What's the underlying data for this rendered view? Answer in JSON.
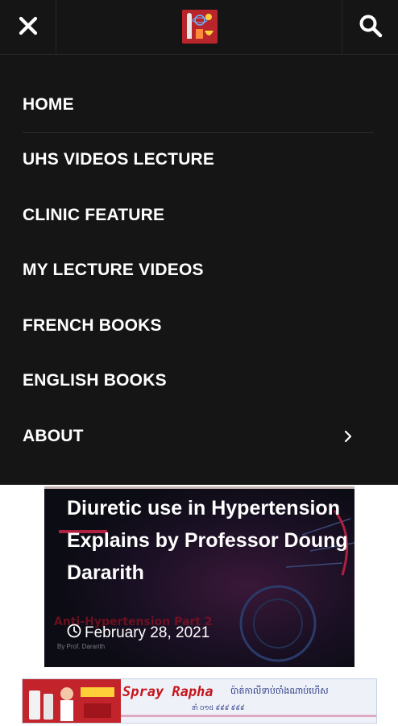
{
  "header": {
    "close_icon": "close-icon",
    "search_icon": "search-icon",
    "logo_icon": "site-logo"
  },
  "menu": {
    "items": [
      {
        "label": "HOME"
      },
      {
        "label": "UHS VIDEOS LECTURE"
      },
      {
        "label": "CLINIC FEATURE"
      },
      {
        "label": "MY LECTURE VIDEOS"
      },
      {
        "label": "FRENCH BOOKS"
      },
      {
        "label": "ENGLISH BOOKS"
      },
      {
        "label": "ABOUT"
      }
    ]
  },
  "post": {
    "title": "Diuretic use in Hypertension Explains by Professor Doung Dararith",
    "date": "February 28, 2021",
    "thumbnail_overlay": "Anti-Hypertension Part 2",
    "thumbnail_byline": "By Prof. Dararith"
  },
  "ad": {
    "title": "Spray Rapha",
    "khmer_text": "ប៉ាត់កាលីទាប់ចាំងណាប់ហើស",
    "subtext": "នាំ ០១៥ ៩៩៩ ៩៩៩"
  },
  "colors": {
    "menu_bg": "#151515",
    "text": "#ffffff",
    "logo_red": "#b8252a",
    "ad_red": "#c4161c"
  }
}
